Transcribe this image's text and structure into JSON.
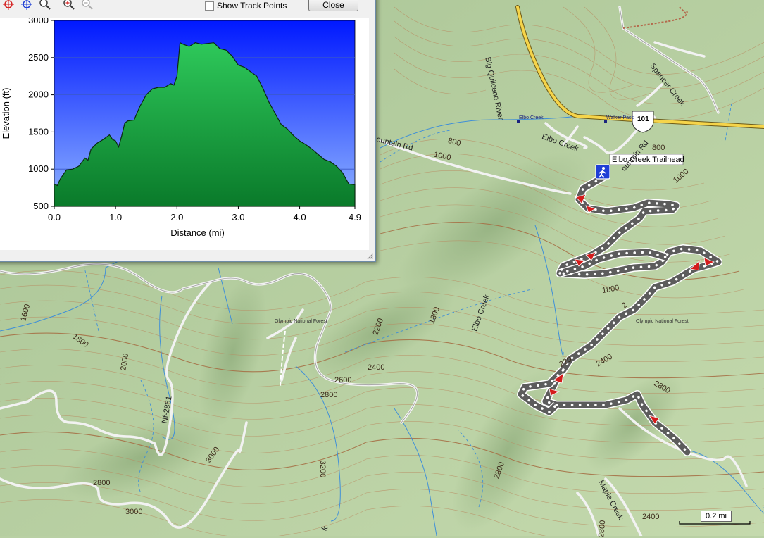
{
  "toolbar": {
    "show_track_points_label": "Show Track Points",
    "close_label": "Close"
  },
  "chart_data": {
    "type": "area",
    "title": "",
    "xlabel": "Distance   (mi)",
    "ylabel": "Elevation (ft)",
    "xlim": [
      0,
      4.9
    ],
    "ylim": [
      500,
      3000
    ],
    "x_ticks": [
      "0.0",
      "1.0",
      "2.0",
      "3.0",
      "4.0",
      "4.9"
    ],
    "y_ticks": [
      "500",
      "1000",
      "1500",
      "2000",
      "2500",
      "3000"
    ],
    "grid": true,
    "series": [
      {
        "x": [
          0.0,
          0.05,
          0.1,
          0.2,
          0.3,
          0.4,
          0.5,
          0.55,
          0.6,
          0.7,
          0.8,
          0.9,
          0.95,
          1.0,
          1.05,
          1.1,
          1.15,
          1.2,
          1.3,
          1.4,
          1.5,
          1.6,
          1.7,
          1.8,
          1.9,
          1.95,
          2.0,
          2.05,
          2.1,
          2.2,
          2.3,
          2.4,
          2.5,
          2.6,
          2.7,
          2.8,
          2.9,
          3.0,
          3.1,
          3.2,
          3.3,
          3.4,
          3.5,
          3.6,
          3.7,
          3.8,
          3.9,
          4.0,
          4.1,
          4.2,
          4.3,
          4.4,
          4.5,
          4.6,
          4.7,
          4.8,
          4.9
        ],
        "y": [
          800,
          780,
          870,
          990,
          1000,
          1040,
          1150,
          1120,
          1270,
          1350,
          1400,
          1460,
          1400,
          1380,
          1300,
          1450,
          1620,
          1650,
          1660,
          1850,
          2000,
          2080,
          2100,
          2100,
          2150,
          2130,
          2250,
          2700,
          2680,
          2650,
          2700,
          2680,
          2690,
          2700,
          2620,
          2600,
          2520,
          2400,
          2370,
          2310,
          2250,
          2090,
          1900,
          1750,
          1600,
          1540,
          1450,
          1380,
          1330,
          1270,
          1200,
          1130,
          1100,
          1040,
          950,
          800,
          790
        ]
      }
    ],
    "fill_color_top": "#2ec85a",
    "fill_color_bottom": "#0a7a2a",
    "bg_color_top": "#0018ff",
    "bg_color_bottom": "#8fb4ff"
  },
  "map": {
    "trailhead_label": "Elbo Creek Trailhead",
    "highway_shield": "101",
    "roads": {
      "river": "Big Quilcene River",
      "spencer": "Spencer Creek",
      "elbo": "Elbo Creek",
      "elbo_creek_vertical": "Elbo Creek",
      "mountain_rd_left": "ountain Rd",
      "mountain_rd_right": "ountain Rd",
      "nf_road": "Nf-2861",
      "maple": "Maple Creek"
    },
    "forest_labels": [
      "Olympic National Forest",
      "Olympic National Forest"
    ],
    "poi_labels": {
      "elbo_creek": "Elbo Creek",
      "walker_pass": "Walker Pass"
    },
    "contours": [
      "800",
      "1000",
      "800",
      "1000",
      "1800",
      "2200",
      "1800",
      "1600",
      "1800",
      "2000",
      "2200",
      "2400",
      "2600",
      "2800",
      "2400",
      "2800",
      "3000",
      "2800",
      "3000",
      "3200",
      "2800",
      "2800",
      "2400",
      "2600",
      "1800",
      "2",
      "220"
    ],
    "scale_label": "0.2 mi",
    "bottom_left_fragment": "k"
  },
  "icons": [
    "select-icon",
    "crosshair-icon",
    "zoom-icon",
    "zoom-in-icon",
    "zoom-out-icon",
    "hiker-icon",
    "highway-shield-icon",
    "waypoint-icon"
  ]
}
